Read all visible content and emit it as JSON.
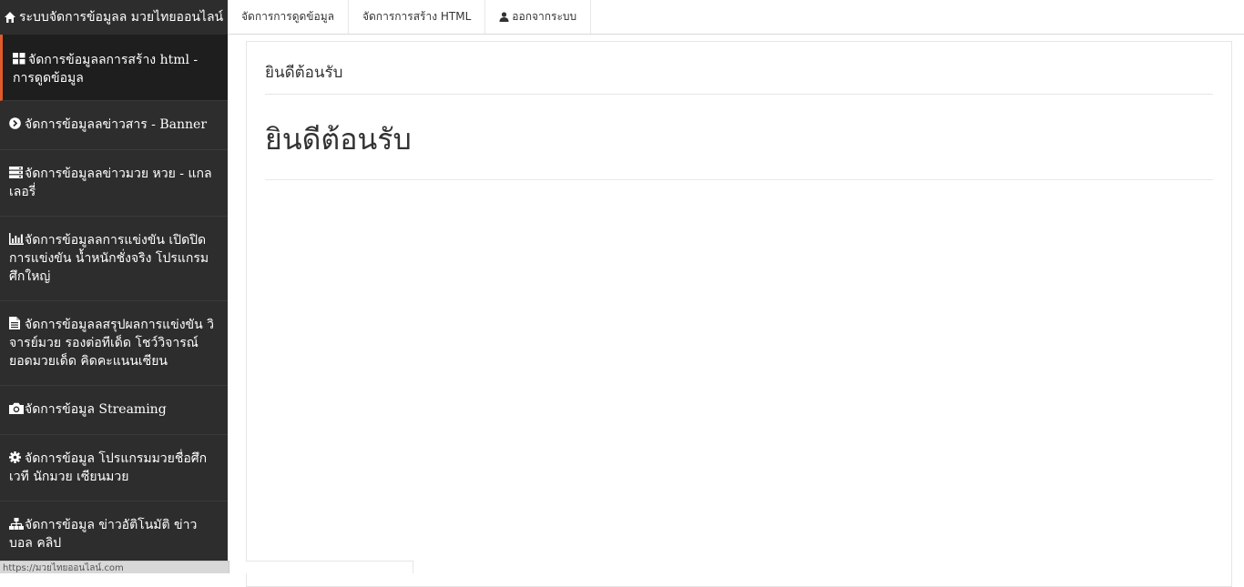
{
  "brand": {
    "title": "ระบบจัดการข้อมูลล มวยไทยออนไลน์",
    "icon": "home-icon"
  },
  "topnav": {
    "items": [
      {
        "label": "จัดการการดูดข้อมูล"
      },
      {
        "label": "จัดการการสร้าง HTML"
      },
      {
        "label": "ออกจากระบบ",
        "icon": "user-icon"
      }
    ]
  },
  "sidebar": {
    "active_color": "#e05a2a",
    "items": [
      {
        "label": "จัดการข้อมูลลการสร้าง html - การดูดข้อมูล",
        "icon": "th-large-icon",
        "active": true
      },
      {
        "label": "จัดการข้อมูลลข่าวสาร - Banner",
        "icon": "chevron-circle-right-icon"
      },
      {
        "label": "จัดการข้อมูลลข่าวมวย หวย - แกลเลอรี่",
        "icon": "server-icon"
      },
      {
        "label": "จัดการข้อมูลลการแข่งขัน เปิดปิดการแข่งขัน น้ำหนักชั่งจริง โปรแกรมศึกใหญ่",
        "icon": "bar-chart-icon"
      },
      {
        "label": "จัดการข้อมูลลสรุปผลการแข่งขัน วิจารย์มวย รองต่อทีเด็ด โชว์วิจารณ์ยอดมวยเด็ด คิดคะแนนเซียน",
        "icon": "file-text-icon"
      },
      {
        "label": "จัดการข้อมูล Streaming",
        "icon": "camera-icon"
      },
      {
        "label": "จัดการข้อมูล โปรแกรมมวยชื่อศึก เวที นักมวย เซียนมวย",
        "icon": "gear-icon"
      },
      {
        "label": "จัดการข้อมูล ข่าวอัติโนมัติ ข่าวบอล คลิป",
        "icon": "sitemap-icon"
      }
    ]
  },
  "main": {
    "panel_heading": "ยินดีต้อนรับ",
    "page_title": "ยินดีต้อนรับ"
  },
  "status_bar": {
    "url": "https://มวยไทยออนไลน์.com"
  }
}
